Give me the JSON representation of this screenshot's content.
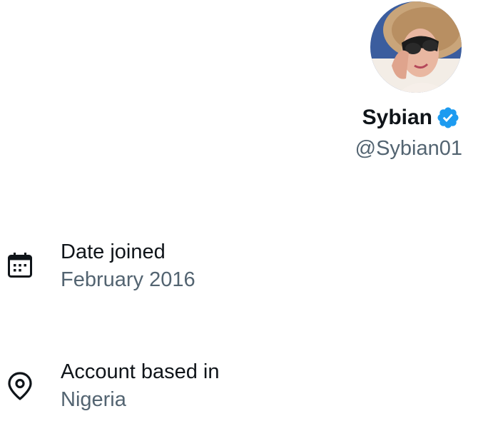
{
  "profile": {
    "display_name": "Sybian",
    "handle": "@Sybian01",
    "verified": true,
    "verified_color": "#1d9bf0"
  },
  "about": [
    {
      "icon": "calendar-icon",
      "label": "Date joined",
      "value": "February 2016"
    },
    {
      "icon": "location-pin-icon",
      "label": "Account based in",
      "value": "Nigeria"
    }
  ],
  "colors": {
    "primary_text": "#0f1419",
    "secondary_text": "#536471"
  }
}
